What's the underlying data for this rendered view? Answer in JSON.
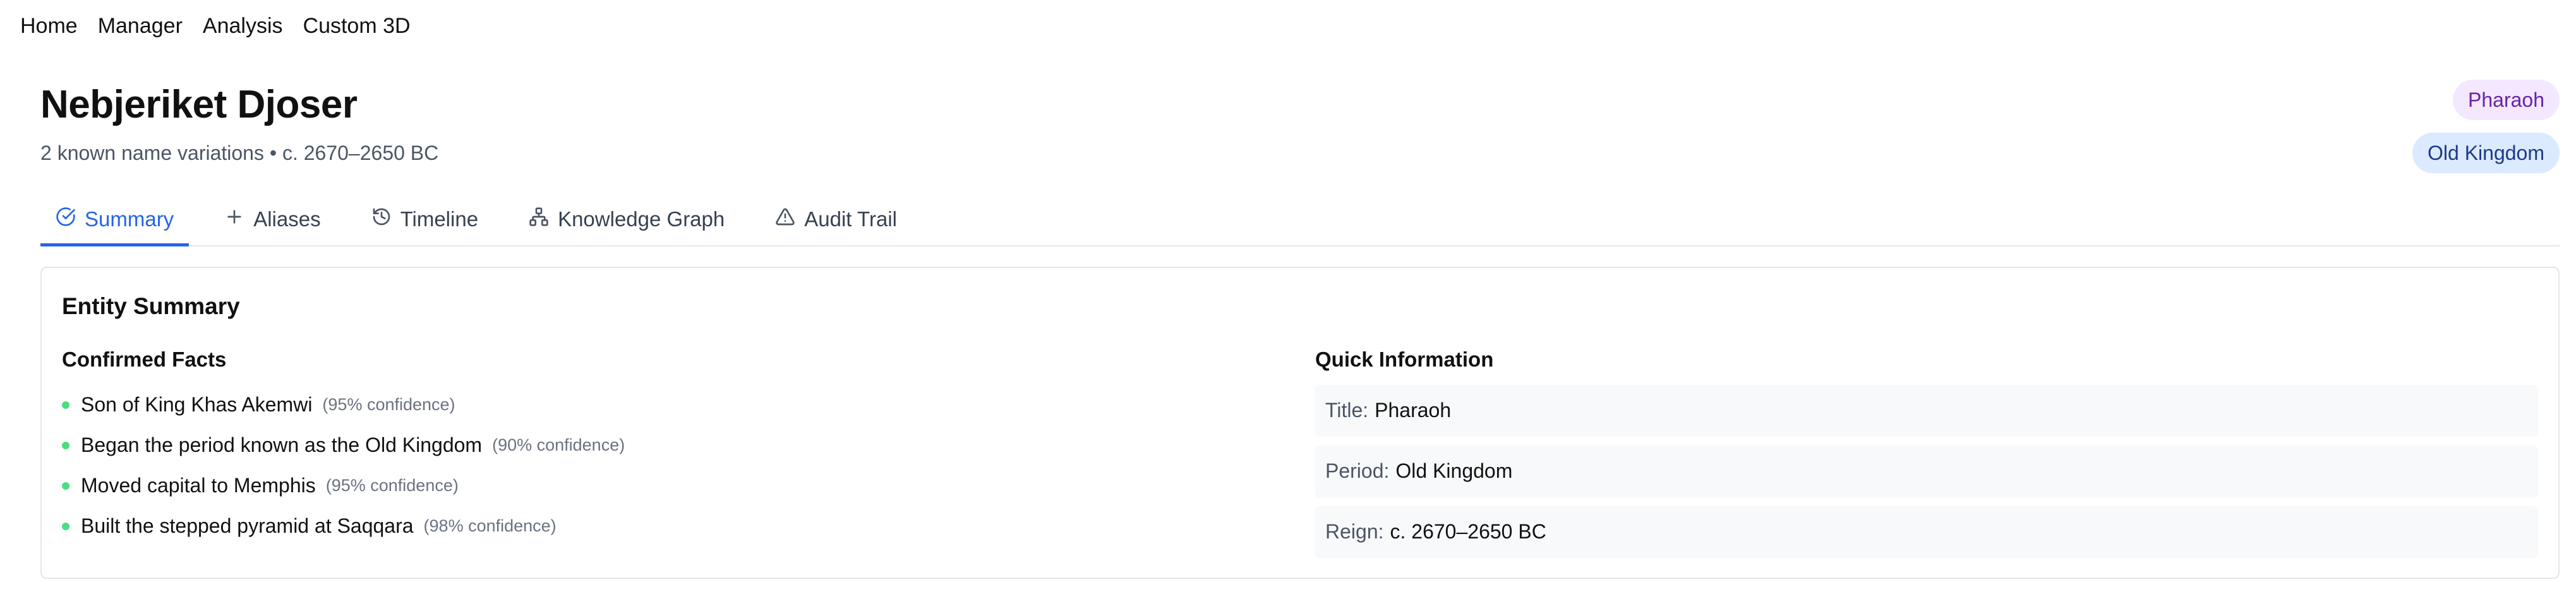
{
  "nav": {
    "items": [
      {
        "label": "Home"
      },
      {
        "label": "Manager"
      },
      {
        "label": "Analysis"
      },
      {
        "label": "Custom 3D"
      }
    ]
  },
  "entity": {
    "name": "Nebjeriket Djoser",
    "subtitle": "2 known name variations • c. 2670–2650 BC",
    "badges": [
      {
        "label": "Pharaoh",
        "color": "#6b21a8",
        "background": "#f3e8ff"
      },
      {
        "label": "Old Kingdom",
        "color": "#1e3a8a",
        "background": "#dbeafe"
      }
    ]
  },
  "tabs": [
    {
      "label": "Summary",
      "icon": "check-circle-icon",
      "active": true
    },
    {
      "label": "Aliases",
      "icon": "plus-icon",
      "active": false
    },
    {
      "label": "Timeline",
      "icon": "history-icon",
      "active": false
    },
    {
      "label": "Knowledge Graph",
      "icon": "network-icon",
      "active": false
    },
    {
      "label": "Audit Trail",
      "icon": "warning-icon",
      "active": false
    }
  ],
  "summary": {
    "title": "Entity Summary",
    "confirmed_facts": {
      "title": "Confirmed Facts",
      "items": [
        {
          "text": "Son of King Khas Akemwi",
          "confidence": "(95% confidence)"
        },
        {
          "text": "Began the period known as the Old Kingdom",
          "confidence": "(90% confidence)"
        },
        {
          "text": "Moved capital to Memphis",
          "confidence": "(95% confidence)"
        },
        {
          "text": "Built the stepped pyramid at Saqqara",
          "confidence": "(98% confidence)"
        }
      ]
    },
    "quick_info": {
      "title": "Quick Information",
      "rows": [
        {
          "label": "Title:",
          "value": "Pharaoh"
        },
        {
          "label": "Period:",
          "value": "Old Kingdom"
        },
        {
          "label": "Reign:",
          "value": "c. 2670–2650 BC"
        }
      ]
    }
  },
  "colors": {
    "accent": "#2563eb",
    "fact_dot": "#4ade80"
  }
}
